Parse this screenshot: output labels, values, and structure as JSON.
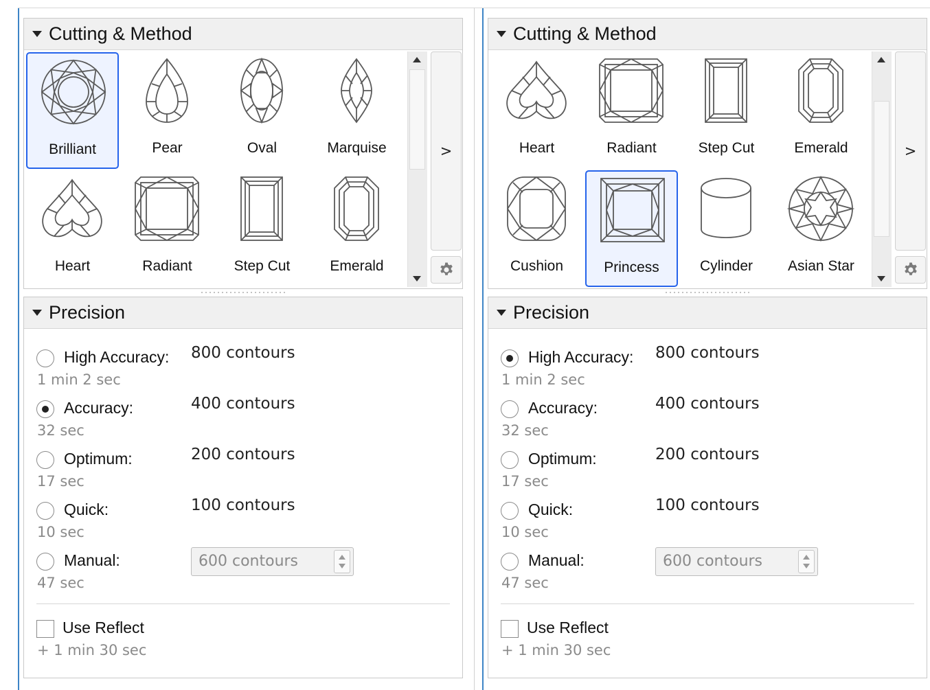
{
  "panels": [
    {
      "cutting_title": "Cutting & Method",
      "next_label": ">",
      "shapes": [
        {
          "label": "Brilliant",
          "icon": "brilliant-icon",
          "selected": true
        },
        {
          "label": "Pear",
          "icon": "pear-icon",
          "selected": false
        },
        {
          "label": "Oval",
          "icon": "oval-icon",
          "selected": false
        },
        {
          "label": "Marquise",
          "icon": "marquise-icon",
          "selected": false
        },
        {
          "label": "Heart",
          "icon": "heart-icon",
          "selected": false
        },
        {
          "label": "Radiant",
          "icon": "radiant-icon",
          "selected": false
        },
        {
          "label": "Step Cut",
          "icon": "step-cut-icon",
          "selected": false
        },
        {
          "label": "Emerald",
          "icon": "emerald-icon",
          "selected": false
        }
      ],
      "precision_title": "Precision",
      "options": [
        {
          "label": "High Accuracy:",
          "value": "800 contours",
          "time": "1 min 2 sec",
          "checked": false
        },
        {
          "label": "Accuracy:",
          "value": "400 contours",
          "time": "32 sec",
          "checked": true
        },
        {
          "label": "Optimum:",
          "value": "200 contours",
          "time": "17 sec",
          "checked": false
        },
        {
          "label": "Quick:",
          "value": "100 contours",
          "time": "10 sec",
          "checked": false
        }
      ],
      "manual": {
        "label": "Manual:",
        "value": "600 contours",
        "time": "47 sec",
        "checked": false
      },
      "reflect": {
        "label": "Use Reflect",
        "time": "+ 1 min 30 sec",
        "checked": false
      }
    },
    {
      "cutting_title": "Cutting & Method",
      "next_label": ">",
      "shapes": [
        {
          "label": "Heart",
          "icon": "heart-icon",
          "selected": false
        },
        {
          "label": "Radiant",
          "icon": "radiant-icon",
          "selected": false
        },
        {
          "label": "Step Cut",
          "icon": "step-cut-icon",
          "selected": false
        },
        {
          "label": "Emerald",
          "icon": "emerald-icon",
          "selected": false
        },
        {
          "label": "Cushion",
          "icon": "cushion-icon",
          "selected": false
        },
        {
          "label": "Princess",
          "icon": "princess-icon",
          "selected": true
        },
        {
          "label": "Cylinder",
          "icon": "cylinder-icon",
          "selected": false
        },
        {
          "label": "Asian Star",
          "icon": "asian-star-icon",
          "selected": false
        }
      ],
      "precision_title": "Precision",
      "options": [
        {
          "label": "High Accuracy:",
          "value": "800 contours",
          "time": "1 min 2 sec",
          "checked": true
        },
        {
          "label": "Accuracy:",
          "value": "400 contours",
          "time": "32 sec",
          "checked": false
        },
        {
          "label": "Optimum:",
          "value": "200 contours",
          "time": "17 sec",
          "checked": false
        },
        {
          "label": "Quick:",
          "value": "100 contours",
          "time": "10 sec",
          "checked": false
        }
      ],
      "manual": {
        "label": "Manual:",
        "value": "600 contours",
        "time": "47 sec",
        "checked": false
      },
      "reflect": {
        "label": "Use Reflect",
        "time": "+ 1 min 30 sec",
        "checked": false
      }
    }
  ],
  "colors": {
    "selection": "#2563eb",
    "selection_fill": "#eef3ff",
    "accent_rule": "#3d84c6",
    "icon_stroke": "#5a5a5a"
  }
}
